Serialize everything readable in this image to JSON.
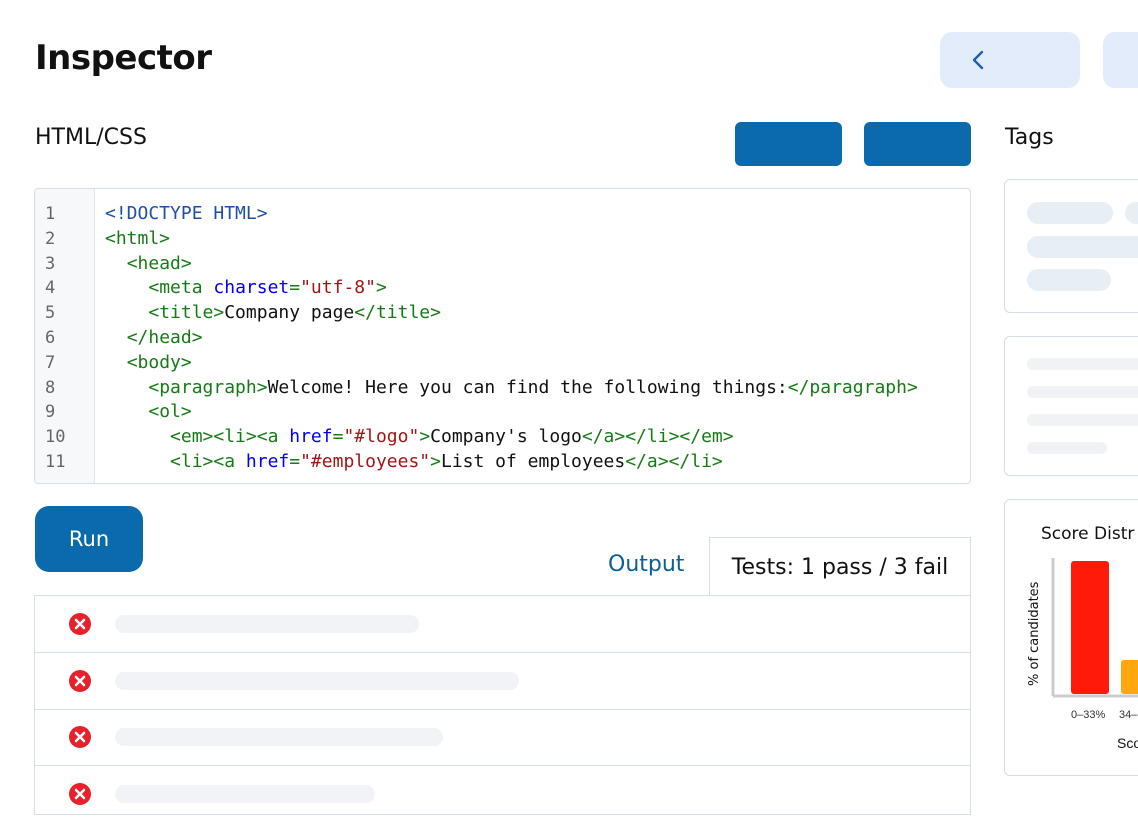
{
  "header": {
    "title": "Inspector",
    "back_icon": "chevron-left-icon"
  },
  "editor": {
    "label": "HTML/CSS",
    "line_numbers": [
      "1",
      "2",
      "3",
      "4",
      "5",
      "6",
      "7",
      "8",
      "9",
      "10",
      "11"
    ],
    "lines": [
      [
        {
          "t": "doc",
          "v": "<!DOCTYPE HTML>"
        }
      ],
      [
        {
          "t": "tag",
          "v": "<html>"
        }
      ],
      [
        {
          "t": "txt",
          "v": "  "
        },
        {
          "t": "tag",
          "v": "<head>"
        }
      ],
      [
        {
          "t": "txt",
          "v": "    "
        },
        {
          "t": "tag",
          "v": "<meta "
        },
        {
          "t": "attr",
          "v": "charset"
        },
        {
          "t": "tag",
          "v": "="
        },
        {
          "t": "str",
          "v": "\"utf-8\""
        },
        {
          "t": "tag",
          "v": ">"
        }
      ],
      [
        {
          "t": "txt",
          "v": "    "
        },
        {
          "t": "tag",
          "v": "<title>"
        },
        {
          "t": "txt",
          "v": "Company page"
        },
        {
          "t": "tag",
          "v": "</title>"
        }
      ],
      [
        {
          "t": "txt",
          "v": "  "
        },
        {
          "t": "tag",
          "v": "</head>"
        }
      ],
      [
        {
          "t": "txt",
          "v": "  "
        },
        {
          "t": "tag",
          "v": "<body>"
        }
      ],
      [
        {
          "t": "txt",
          "v": "    "
        },
        {
          "t": "tag",
          "v": "<paragraph>"
        },
        {
          "t": "txt",
          "v": "Welcome! Here you can find the following things:"
        },
        {
          "t": "tag",
          "v": "</paragraph>"
        }
      ],
      [
        {
          "t": "txt",
          "v": "    "
        },
        {
          "t": "tag",
          "v": "<ol>"
        }
      ],
      [
        {
          "t": "txt",
          "v": "      "
        },
        {
          "t": "tag",
          "v": "<em><li><a "
        },
        {
          "t": "attr",
          "v": "href"
        },
        {
          "t": "tag",
          "v": "="
        },
        {
          "t": "str",
          "v": "\"#logo\""
        },
        {
          "t": "tag",
          "v": ">"
        },
        {
          "t": "txt",
          "v": "Company's logo"
        },
        {
          "t": "tag",
          "v": "</a></li></em>"
        }
      ],
      [
        {
          "t": "txt",
          "v": "      "
        },
        {
          "t": "tag",
          "v": "<li><a "
        },
        {
          "t": "attr",
          "v": "href"
        },
        {
          "t": "tag",
          "v": "="
        },
        {
          "t": "str",
          "v": "\"#employees\""
        },
        {
          "t": "tag",
          "v": ">"
        },
        {
          "t": "txt",
          "v": "List of employees"
        },
        {
          "t": "tag",
          "v": "</a></li>"
        }
      ]
    ]
  },
  "actions": {
    "run_label": "Run"
  },
  "output_tabs": {
    "output_label": "Output",
    "tests_label": "Tests: 1 pass / 3 fail"
  },
  "test_results": [
    {
      "status": "fail"
    },
    {
      "status": "fail"
    },
    {
      "status": "fail"
    },
    {
      "status": "fail"
    }
  ],
  "sidebar": {
    "tags_label": "Tags",
    "chart": {
      "title": "Score Distr",
      "ylabel": "% of candidates",
      "xlabel": "Sco",
      "categories": [
        "0–33%",
        "34–"
      ],
      "colors": [
        "#ff1a0a",
        "#ffa70f"
      ]
    }
  },
  "colors": {
    "accent": "#0a6aac",
    "fail": "#e8202b"
  }
}
